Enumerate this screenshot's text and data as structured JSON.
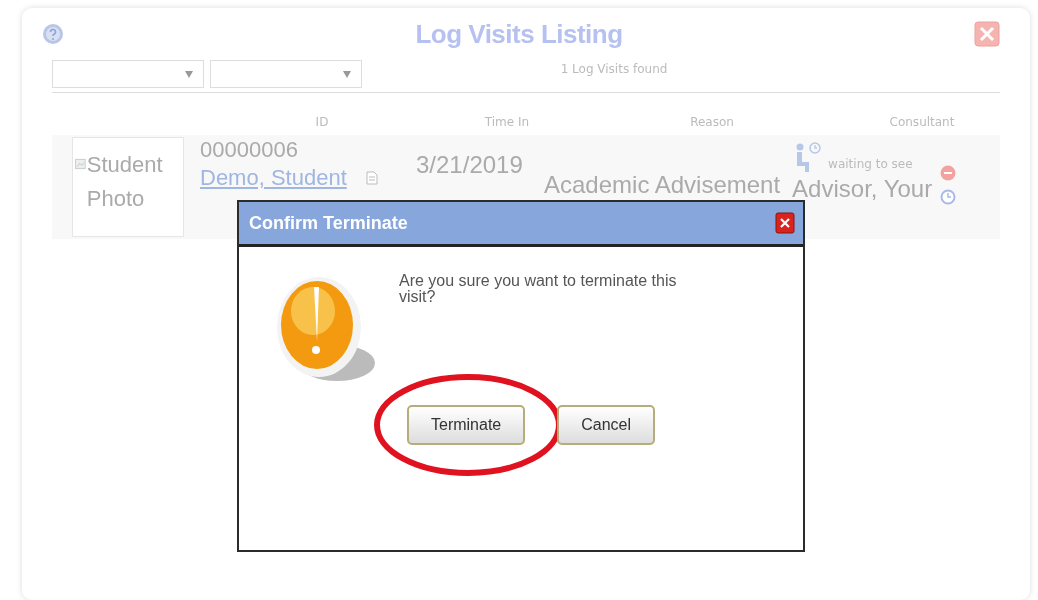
{
  "window": {
    "title": "Log Visits Listing"
  },
  "filters": [
    {
      "kind": "dropdown"
    },
    {
      "kind": "dropdown"
    }
  ],
  "result_count": "1 Log Visits found",
  "table": {
    "columns": [
      "ID",
      "Time In",
      "Reason",
      "Consultant"
    ],
    "rows": [
      {
        "photo_alt": "Student Photo",
        "id": "00000006",
        "name": "Demo, Student",
        "time_in": "3/21/2019",
        "reason": "Academic Advisement",
        "status": "waiting to see",
        "consultant": "Advisor, Your"
      }
    ]
  },
  "dialog": {
    "title": "Confirm Terminate",
    "message": "Are you sure you want to terminate this visit?",
    "buttons": [
      {
        "label": "Terminate",
        "highlighted": true
      },
      {
        "label": "Cancel",
        "highlighted": false
      }
    ]
  }
}
